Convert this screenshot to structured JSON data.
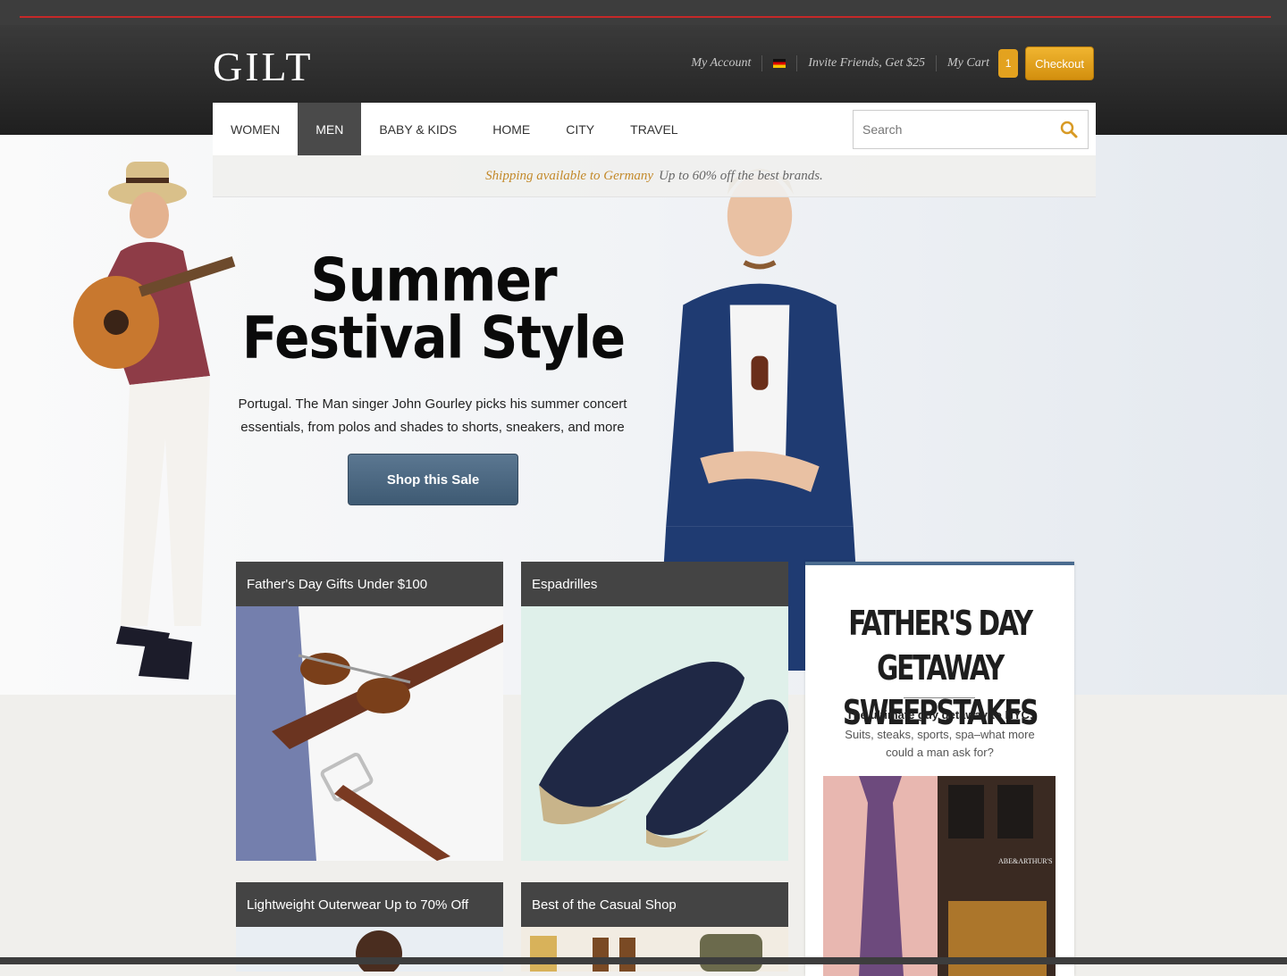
{
  "header": {
    "logo": "GILT",
    "my_account": "My Account",
    "invite": "Invite Friends, Get $25",
    "my_cart": "My Cart",
    "cart_count": "1",
    "checkout": "Checkout"
  },
  "nav": {
    "items": [
      "WOMEN",
      "MEN",
      "BABY & KIDS",
      "HOME",
      "CITY",
      "TRAVEL"
    ],
    "active": "MEN",
    "search_placeholder": "Search"
  },
  "promo": {
    "shipping": "Shipping available to Germany",
    "tagline": "Up to 60% off the best brands."
  },
  "hero": {
    "title_line1": "Summer",
    "title_line2": "Festival Style",
    "subtitle": "Portugal. The Man singer John Gourley picks his summer concert essentials, from polos and shades to shorts, sneakers, and more",
    "button": "Shop this Sale"
  },
  "tiles": [
    {
      "label": "Father's Day Gifts Under $100"
    },
    {
      "label": "Espadrilles"
    },
    {
      "label": "Lightweight Outerwear Up to 70% Off"
    },
    {
      "label": "Best of the Casual Shop"
    }
  ],
  "sweepstakes": {
    "title_line1": "FATHER'S DAY GETAWAY",
    "title_line2": "SWEEPSTAKES",
    "lead": "The ultimate guy getaway to NYC:",
    "desc": "Suits, steaks, sports, spa–what more could a man ask for?",
    "sign": "ABE&ARTHUR'S"
  },
  "colors": {
    "accent": "#e3a21f",
    "nav_active": "#4a4a4a",
    "hero_button": "#4a6782",
    "promo_gold": "#c3892a"
  }
}
